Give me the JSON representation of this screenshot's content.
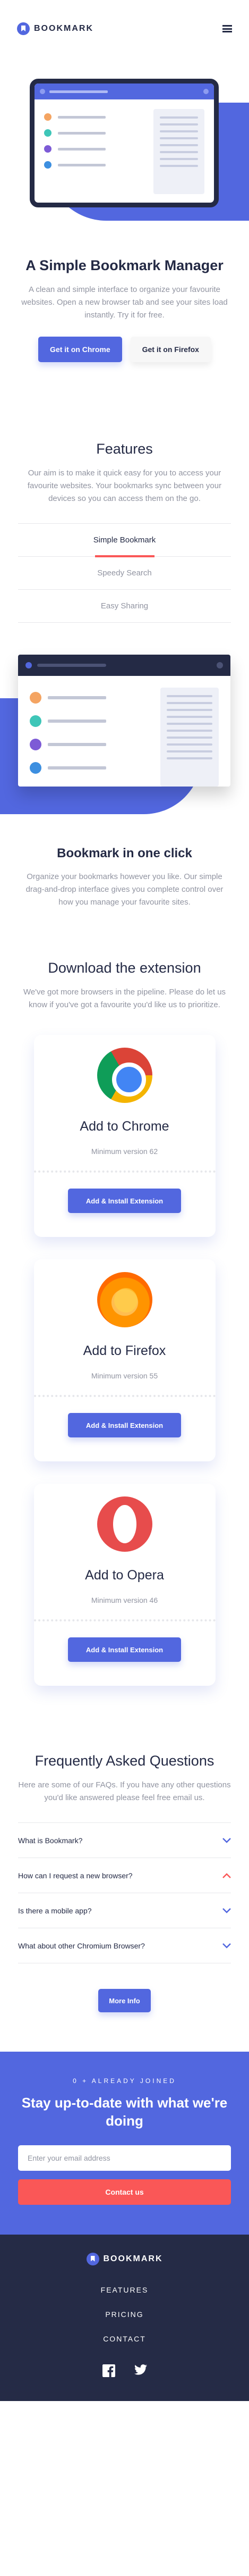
{
  "header": {
    "logo_text": "BOOKMARK"
  },
  "hero": {
    "title": "A Simple Bookmark Manager",
    "description": "A clean and simple interface to organize your favourite websites. Open a new browser tab and see your sites load instantly. Try it for free.",
    "primary_button": "Get it on Chrome",
    "secondary_button": "Get it on Firefox"
  },
  "features": {
    "title": "Features",
    "description": "Our aim is to make it quick easy for you to access your favourite websites. Your bookmarks sync between your devices so you can access them on the go.",
    "tabs": [
      {
        "label": "Simple Bookmark",
        "active": true
      },
      {
        "label": "Speedy Search",
        "active": false
      },
      {
        "label": "Easy Sharing",
        "active": false
      }
    ],
    "panel_title": "Bookmark in one click",
    "panel_description": "Organize your bookmarks however you like. Our simple drag-and-drop interface gives you complete control over how you manage your favourite sites."
  },
  "extensions": {
    "title": "Download the extension",
    "description": "We've got more browsers in the pipeline. Please do let us know if you've got a favourite you'd like us to prioritize.",
    "cards": [
      {
        "name": "Add to Chrome",
        "version": "Minimum version 62",
        "button": "Add & Install Extension",
        "icon": "chrome-icon"
      },
      {
        "name": "Add to Firefox",
        "version": "Minimum version 55",
        "button": "Add & Install Extension",
        "icon": "firefox-icon"
      },
      {
        "name": "Add to Opera",
        "version": "Minimum version 46",
        "button": "Add & Install Extension",
        "icon": "opera-icon"
      }
    ]
  },
  "faq": {
    "title": "Frequently Asked Questions",
    "description": "Here are some of our FAQs. If you have any other questions you'd like answered please feel free email us.",
    "items": [
      {
        "question": "What is Bookmark?",
        "open": false
      },
      {
        "question": "How can I request a new browser?",
        "open": true
      },
      {
        "question": "Is there a mobile app?",
        "open": false
      },
      {
        "question": "What about other Chromium Browser?",
        "open": false
      }
    ],
    "button": "More Info"
  },
  "cta": {
    "eyebrow": "0 + ALREADY JOINED",
    "title": "Stay up-to-date with what we're doing",
    "email_placeholder": "Enter your email address",
    "button": "Contact us"
  },
  "footer": {
    "logo_text": "BOOKMARK",
    "links": [
      "FEATURES",
      "PRICING",
      "CONTACT"
    ]
  },
  "colors": {
    "primary": "#5267df",
    "accent_red": "#fa5757",
    "dark_navy": "#242a45",
    "footer_bg": "#252b46",
    "text_muted": "#9194a1",
    "chevron_closed": "#5267df",
    "chevron_open": "#fa5757"
  }
}
